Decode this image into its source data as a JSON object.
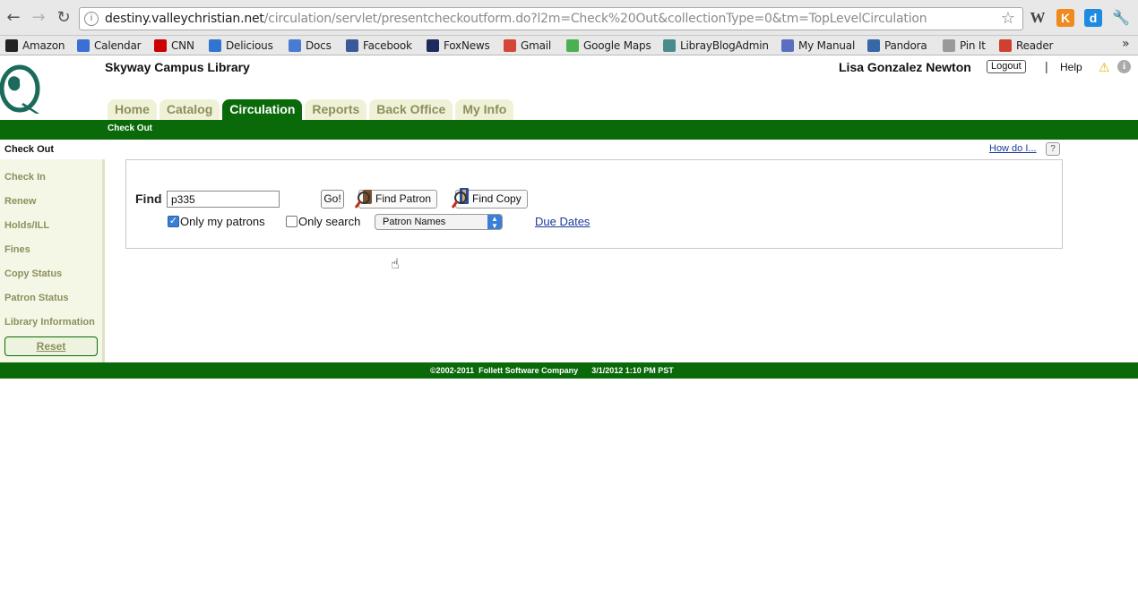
{
  "browser": {
    "url_host": "destiny.valleychristian.net",
    "url_path": "/circulation/servlet/presentcheckoutform.do?l2m=Check%20Out&collectionType=0&tm=TopLevelCirculation",
    "bookmarks": [
      {
        "label": "Amazon",
        "icon": "amazon-icon",
        "color": "#222222"
      },
      {
        "label": "Calendar",
        "icon": "calendar-icon",
        "color": "#3a6fd8"
      },
      {
        "label": "CNN",
        "icon": "cnn-icon",
        "color": "#cc0000"
      },
      {
        "label": "Delicious",
        "icon": "delicious-icon",
        "color": "#3274d1"
      },
      {
        "label": "Docs",
        "icon": "docs-icon",
        "color": "#4a7bd0"
      },
      {
        "label": "Facebook",
        "icon": "facebook-icon",
        "color": "#3b5998"
      },
      {
        "label": "FoxNews",
        "icon": "foxnews-icon",
        "color": "#1d2a5c"
      },
      {
        "label": "Gmail",
        "icon": "gmail-icon",
        "color": "#d44638"
      },
      {
        "label": "Google Maps",
        "icon": "maps-icon",
        "color": "#4caf50"
      },
      {
        "label": "LibrayBlogAdmin",
        "icon": "blog-icon",
        "color": "#4a8c8c"
      },
      {
        "label": "My Manual",
        "icon": "manual-icon",
        "color": "#5a6fc0"
      },
      {
        "label": "Pandora",
        "icon": "pandora-icon",
        "color": "#3668a8"
      },
      {
        "label": "Pin It",
        "icon": "pin-icon",
        "color": "#999999"
      },
      {
        "label": "Reader",
        "icon": "reader-icon",
        "color": "#d04030"
      }
    ],
    "extension_w": "W",
    "extension_k": "K"
  },
  "header": {
    "site_title": "Skyway Campus Library",
    "user_name": "Lisa Gonzalez Newton",
    "logout_label": "Logout",
    "separator": "|",
    "help_label": "Help"
  },
  "tabs": [
    {
      "label": "Home",
      "active": false
    },
    {
      "label": "Catalog",
      "active": false
    },
    {
      "label": "Circulation",
      "active": true
    },
    {
      "label": "Reports",
      "active": false
    },
    {
      "label": "Back Office",
      "active": false
    },
    {
      "label": "My Info",
      "active": false
    }
  ],
  "subnav": {
    "current": "Check Out"
  },
  "sidebar": {
    "items": [
      {
        "label": "Check Out",
        "active": true
      },
      {
        "label": "Check In",
        "active": false
      },
      {
        "label": "Renew",
        "active": false
      },
      {
        "label": "Holds/ILL",
        "active": false
      },
      {
        "label": "Fines",
        "active": false
      },
      {
        "label": "Copy Status",
        "active": false
      },
      {
        "label": "Patron Status",
        "active": false
      },
      {
        "label": "Library Information",
        "active": false
      }
    ],
    "reset_label": "Reset"
  },
  "help": {
    "how_do_i": "How do I...",
    "question": "?"
  },
  "form": {
    "find_label": "Find",
    "find_value": "p335",
    "go_label": "Go!",
    "find_patron_label": "Find Patron",
    "find_copy_label": "Find Copy",
    "only_my_patrons_label": "Only my patrons",
    "only_my_patrons_checked": true,
    "only_search_label": "Only search",
    "only_search_checked": false,
    "search_scope": "Patron Names",
    "due_dates_label": "Due Dates"
  },
  "footer": {
    "text": "©2002-2011  Follett Software Company      3/1/2012 1:10 PM PST"
  },
  "colors": {
    "brand_green": "#0a6a0a",
    "tab_inactive_text": "#8c8f5c",
    "link_blue": "#1a3a9a"
  }
}
